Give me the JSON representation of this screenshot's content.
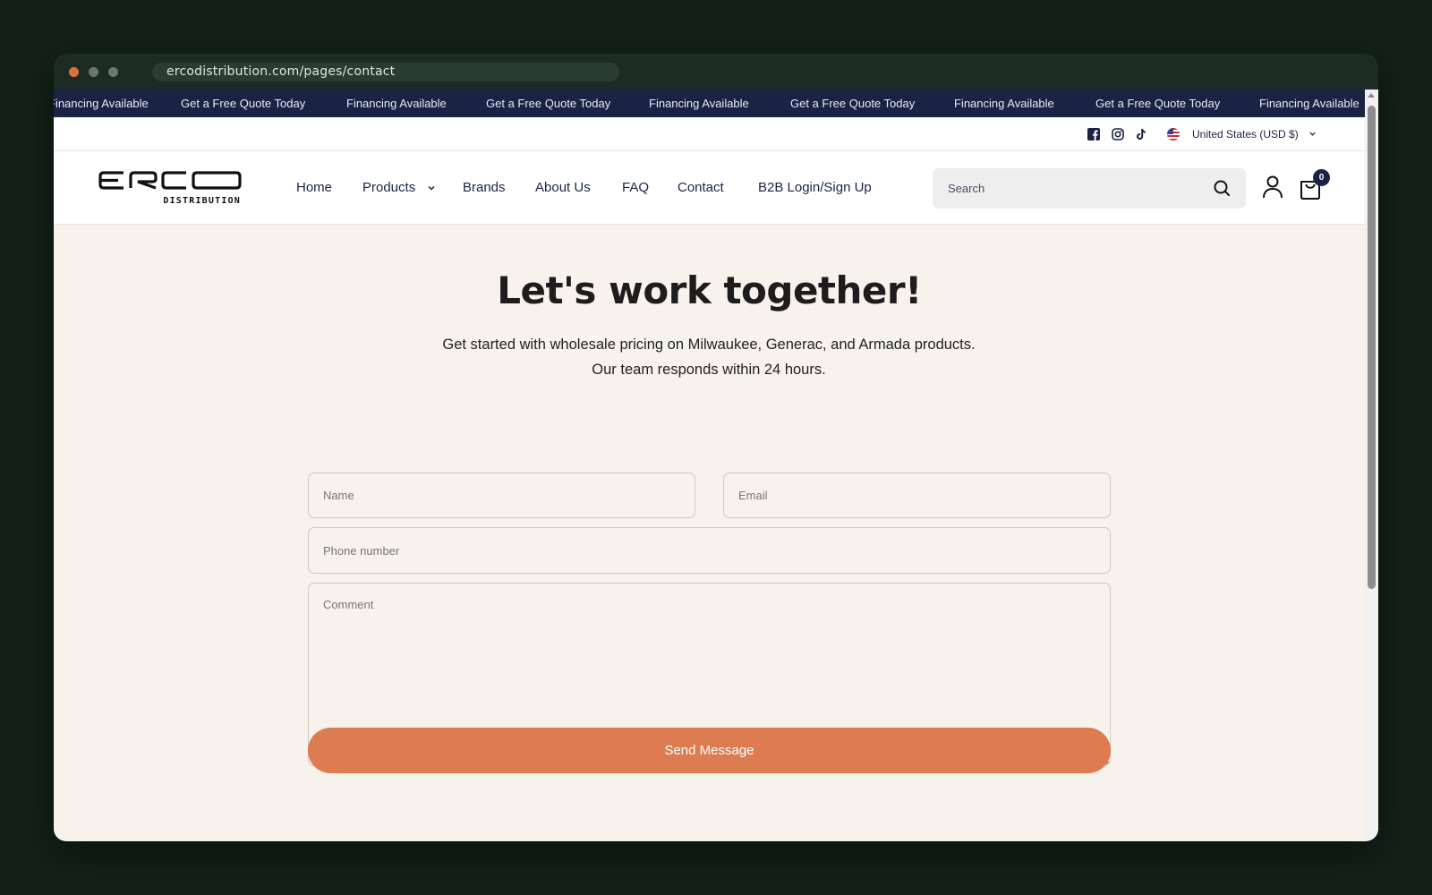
{
  "browser": {
    "url": "ercodistribution.com/pages/contact"
  },
  "announcement": {
    "items": [
      "Financing Available",
      "Get a Free Quote Today",
      "Financing Available",
      "Get a Free Quote Today",
      "Financing Available",
      "Get a Free Quote Today",
      "Financing Available",
      "Get a Free Quote Today",
      "Financing Available"
    ]
  },
  "topbar": {
    "social_icons": [
      "facebook-icon",
      "instagram-icon",
      "tiktok-icon"
    ],
    "region_label": "United States (USD $)",
    "flag_icon": "us-flag-icon"
  },
  "header": {
    "logo": {
      "wordmark": "ERCO",
      "subtext": "DISTRIBUTION"
    },
    "nav": [
      "Home",
      "Products",
      "Brands",
      "About Us",
      "FAQ",
      "Contact",
      "B2B Login/Sign Up"
    ],
    "search_placeholder": "Search",
    "cart_count": "0"
  },
  "contact": {
    "title": "Let's work together!",
    "subtitle": "Get started with wholesale pricing on Milwaukee, Generac, and Armada products. Our team responds within 24 hours.",
    "name_placeholder": "Name",
    "email_placeholder": "Email",
    "phone_placeholder": "Phone number",
    "comment_placeholder": "Comment",
    "submit_label": "Send Message"
  },
  "colors": {
    "announcement_bg": "#1b2344",
    "page_bg": "#f8f2ec",
    "accent": "#dc7c50",
    "window_frame": "#1c2b24"
  }
}
